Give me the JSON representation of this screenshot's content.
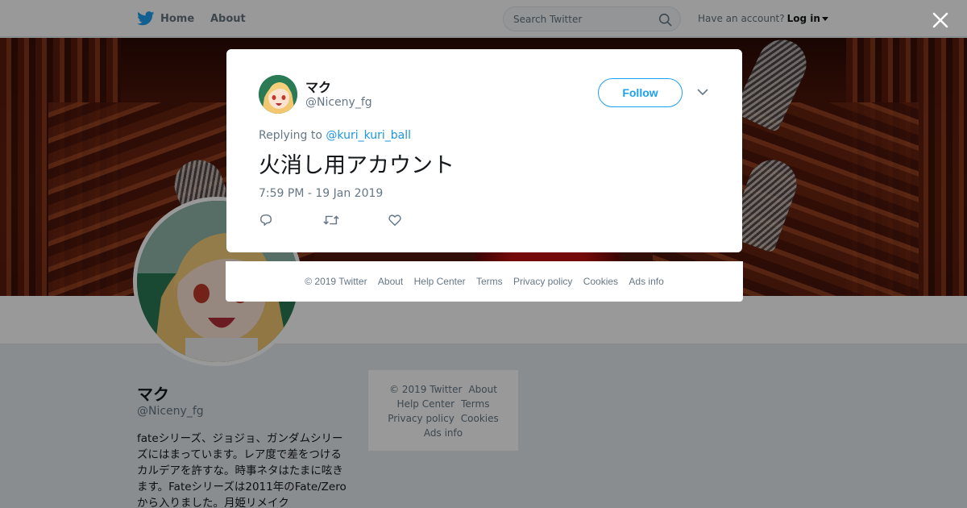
{
  "topbar": {
    "home_label": "Home",
    "about_label": "About",
    "search_placeholder": "Search Twitter",
    "have_account": "Have an account?",
    "login_label": "Log in"
  },
  "profile": {
    "name": "マク",
    "handle": "@Niceny_fg",
    "bio": "fateシリーズ、ジョジョ、ガンダムシリーズにはまっています。レア度で差をつけるカルデアを許すな。時事ネタはたまに呟きます。Fateシリーズは2011年のFate/Zeroから入りました。月姫リメイク"
  },
  "side_footer": {
    "copyright": "© 2019 Twitter",
    "about": "About",
    "help": "Help Center",
    "terms": "Terms",
    "privacy": "Privacy policy",
    "cookies": "Cookies",
    "ads": "Ads info"
  },
  "tweet": {
    "name": "マク",
    "handle": "@Niceny_fg",
    "follow_label": "Follow",
    "replying_prefix": "Replying to",
    "replying_to": "@kuri_kuri_ball",
    "text": "火消し用アカウント",
    "timestamp": "7:59 PM - 19 Jan 2019"
  },
  "modal_footer": {
    "copyright": "© 2019 Twitter",
    "about": "About",
    "help": "Help Center",
    "terms": "Terms",
    "privacy": "Privacy policy",
    "cookies": "Cookies",
    "ads": "Ads info"
  },
  "colors": {
    "brand": "#1da1f2",
    "link": "#1b95e0",
    "secondary_text": "#657786"
  }
}
